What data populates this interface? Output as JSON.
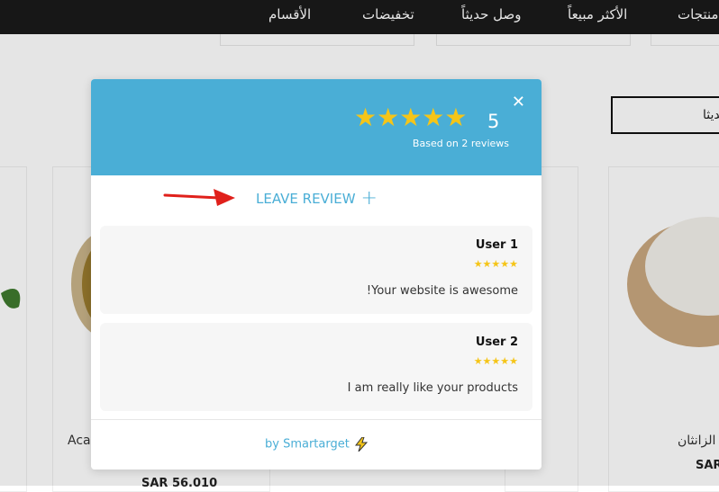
{
  "nav": {
    "items": [
      "منتجات",
      "الأكثر مبيعاً",
      "وصل حديثاً",
      "تخفيضات",
      "الأقسام"
    ]
  },
  "background": {
    "outline_button": "حديثا",
    "cards": [
      {
        "title": "Aca",
        "price": "SAR 56.010"
      },
      {
        "title": "الزانثان",
        "price": "SAR"
      }
    ]
  },
  "modal": {
    "close_icon": "close-icon",
    "rating_stars": "★★★★★",
    "rating_value": "5",
    "reviews_count": "Based on 2 reviews",
    "leave_review_label": "LEAVE REVIEW",
    "plus_icon": "+",
    "reviews": [
      {
        "name": "User 1",
        "stars": "★★★★★",
        "text": "!Your website is awesome"
      },
      {
        "name": "User 2",
        "stars": "★★★★★",
        "text": "I am really like your products"
      }
    ],
    "footer": "by Smartarget"
  },
  "colors": {
    "header": "#4aaed6",
    "star": "#f5c518",
    "nav_bg": "#1a1a1a",
    "arrow": "#e0201b"
  }
}
